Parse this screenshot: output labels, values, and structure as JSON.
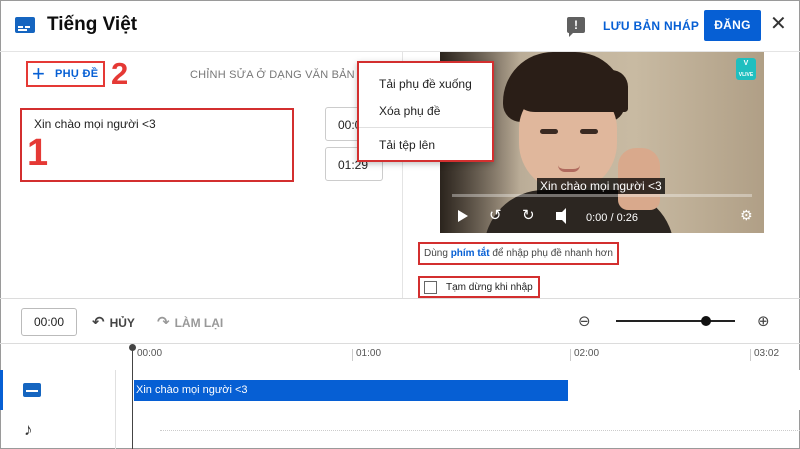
{
  "header": {
    "language": "Tiếng Việt",
    "save_draft": "LƯU BẢN NHÁP",
    "publish": "ĐĂNG"
  },
  "editor": {
    "add_subtitle": "PHỤ ĐỀ",
    "edit_as_text": "CHỈNH SỬA Ở DẠNG VĂN BẢN",
    "subtitle_text": "Xin chào mọi người <3",
    "start_time": "00:00",
    "end_time": "01:29"
  },
  "annotations": {
    "label_1": "1",
    "label_2": "2"
  },
  "menu": {
    "items": [
      "Tải phụ đề xuống",
      "Xóa phụ đề",
      "Tải tệp lên"
    ]
  },
  "video": {
    "caption": "Xin chào mọi người <3",
    "time_display": "0:00 / 0:26",
    "progress": 0,
    "channel_logo": "VLIVE"
  },
  "shortcut": {
    "prefix": "Dùng ",
    "link": "phím tắt",
    "suffix": " để nhập phụ đề nhanh hơn"
  },
  "pause_while_typing": {
    "label": "Tạm dừng khi nhập",
    "checked": false
  },
  "timeline": {
    "current_time": "00:00",
    "undo": "HỦY",
    "redo": "LÀM LẠI",
    "zoom_level": 0.76,
    "ruler": [
      "00:00",
      "01:00",
      "02:00",
      "03:02"
    ],
    "track_caption": "Xin chào mọi người <3"
  },
  "colors": {
    "accent": "#065fd4",
    "annotation": "#d32f2f"
  }
}
